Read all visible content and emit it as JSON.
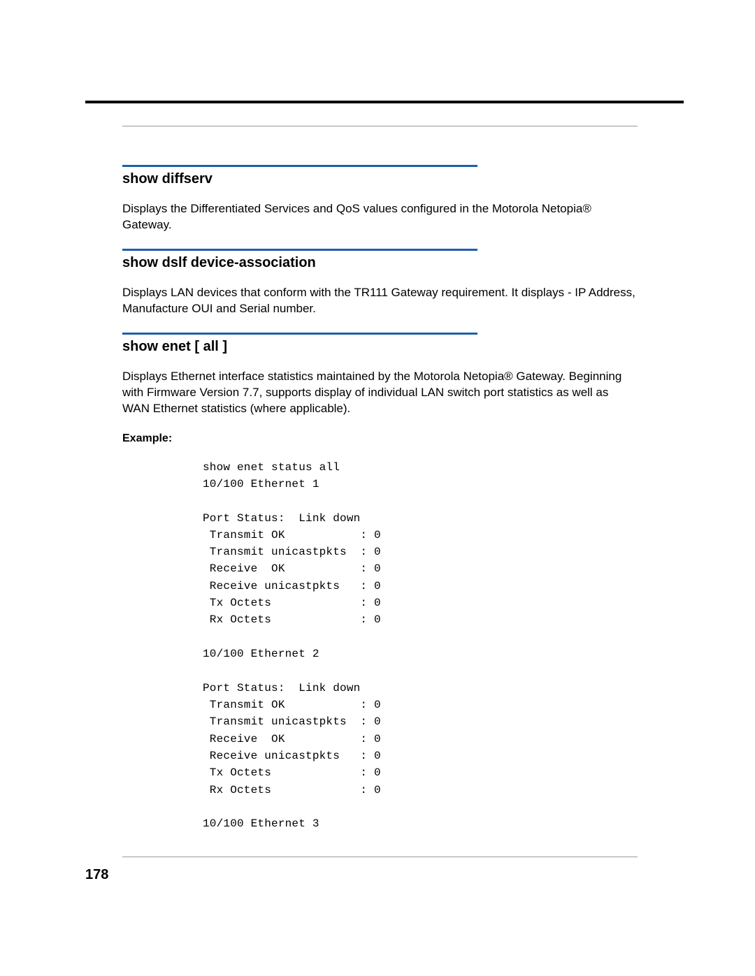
{
  "page_number": "178",
  "sections": [
    {
      "heading": "show diffserv",
      "body": "Displays the Differentiated Services and QoS values configured in the Motorola Netopia® Gateway."
    },
    {
      "heading": "show dslf device-association",
      "body": "Displays LAN devices that conform with the TR111 Gateway requirement. It displays - IP Address, Manufacture OUI and Serial number."
    },
    {
      "heading": "show enet [ all ]",
      "body": "Displays Ethernet interface statistics maintained by the Motorola Netopia® Gateway. Beginning with Firmware Version 7.7, supports display of individual LAN switch port statistics as well as WAN Ethernet statistics (where applicable).",
      "example_label": "Example:",
      "example_code": "show enet status all\n10/100 Ethernet 1\n\nPort Status:  Link down\n Transmit OK           : 0\n Transmit unicastpkts  : 0\n Receive  OK           : 0\n Receive unicastpkts   : 0\n Tx Octets             : 0\n Rx Octets             : 0\n\n10/100 Ethernet 2\n\nPort Status:  Link down\n Transmit OK           : 0\n Transmit unicastpkts  : 0\n Receive  OK           : 0\n Receive unicastpkts   : 0\n Tx Octets             : 0\n Rx Octets             : 0\n\n10/100 Ethernet 3"
    }
  ]
}
